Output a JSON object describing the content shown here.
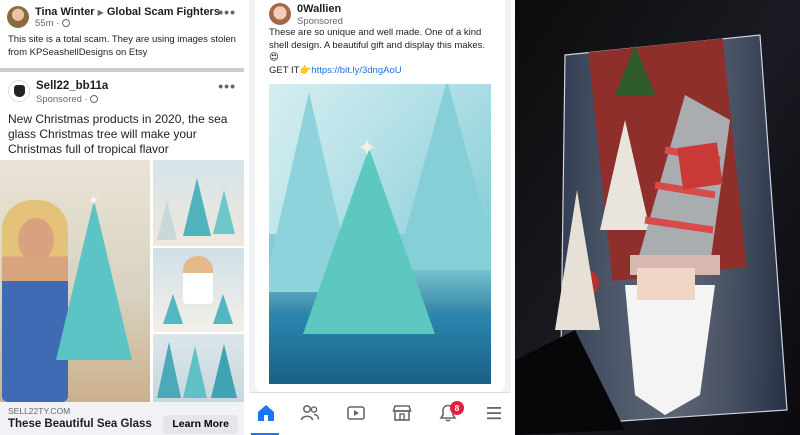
{
  "left_post": {
    "author": "Tina Winter",
    "group": "Global Scam Fighters",
    "time": "55m",
    "text": "This site is a total scam. They are using images stolen from KPSeashellDesigns on Etsy",
    "more": "•••"
  },
  "left_ad": {
    "advertiser": "Sell22_bb11a",
    "sponsored": "Sponsored",
    "text": "New Christmas products in 2020, the sea glass Christmas tree will make your Christmas full of tropical flavor",
    "more": "•••",
    "link": {
      "domain": "SELL22TY.COM",
      "title": "These Beautiful Sea Glass",
      "button": "Learn More"
    }
  },
  "mid_post": {
    "advertiser": "0Wallien",
    "sponsored": "Sponsored",
    "text": "These are so unique and well made. One of a kind shell design. A beautiful gift and display this makes. 😍",
    "cta_prefix": "GET IT👉",
    "url": "https://bit.ly/3dngAoU"
  },
  "tabbar": {
    "tabs": [
      {
        "name": "home",
        "icon": "home-icon",
        "active": true
      },
      {
        "name": "friends",
        "icon": "friends-icon",
        "active": false
      },
      {
        "name": "watch",
        "icon": "video-icon",
        "active": false
      },
      {
        "name": "marketplace",
        "icon": "marketplace-icon",
        "active": false
      },
      {
        "name": "notifications",
        "icon": "bell-icon",
        "active": false
      },
      {
        "name": "menu",
        "icon": "hamburger-icon",
        "active": false
      }
    ],
    "notification_count": "8"
  },
  "colors": {
    "facebook_blue": "#1877f2",
    "link_blue": "#216fdb",
    "badge_red": "#e41e3f",
    "sea_glass": "#5cc4c4"
  }
}
